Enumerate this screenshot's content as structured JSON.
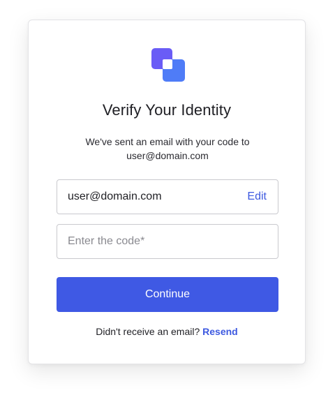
{
  "brand": {
    "logo_icon": "overlapping-squares-logo-icon",
    "colors": {
      "back": "#6a5cf6",
      "front": "#4f7cf7",
      "inner": "#ffffff"
    }
  },
  "page": {
    "title": "Verify Your Identity",
    "subtitle_line1": "We've sent an email with your code to",
    "subtitle_line2": "user@domain.com"
  },
  "email_field": {
    "value": "user@domain.com",
    "edit_label": "Edit"
  },
  "code_field": {
    "placeholder": "Enter the code*",
    "value": ""
  },
  "continue_button": {
    "label": "Continue",
    "color": "#3f59e4"
  },
  "footer": {
    "prompt": "Didn't receive an email?",
    "resend_label": "Resend",
    "link_color": "#3d59e0"
  }
}
